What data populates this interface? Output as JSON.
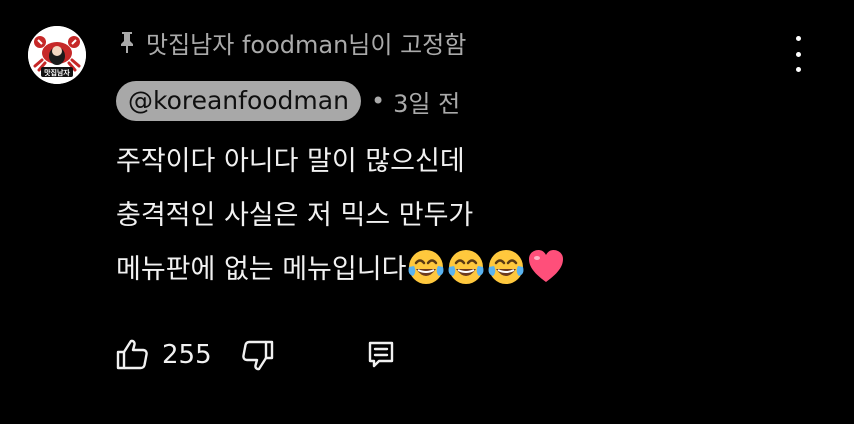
{
  "comment": {
    "pinned_text": "맛집남자 foodman님이 고정함",
    "author_handle": "@koreanfoodman",
    "separator": "•",
    "timestamp": "3일 전",
    "body_lines": [
      "주작이다 아니다 말이 많으신데",
      "충격적인 사실은 저 믹스 만두가",
      "메뉴판에 없는 메뉴입니다"
    ],
    "emojis": [
      "face-with-tears-of-joy",
      "face-with-tears-of-joy",
      "face-with-tears-of-joy",
      "red-heart"
    ],
    "like_count": "255",
    "avatar_text": "맛집남자"
  },
  "icons": {
    "pin": "pin-icon",
    "more": "more-vert-icon",
    "like": "thumb-up-icon",
    "dislike": "thumb-down-icon",
    "reply": "reply-icon"
  },
  "colors": {
    "background": "#000000",
    "text": "#f1f1f1",
    "secondary_text": "#aaaaaa",
    "handle_chip_bg": "#a8a8a8",
    "heart": "#ff4f7a",
    "avatar_crab": "#c62828"
  }
}
